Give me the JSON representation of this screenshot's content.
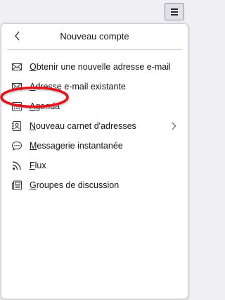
{
  "toolbar": {
    "menu_icon": "hamburger-menu-icon"
  },
  "panel": {
    "title": "Nouveau compte",
    "back_icon": "chevron-left-icon"
  },
  "items": [
    {
      "accel": "O",
      "rest": "btenir une nouvelle adresse e-mail",
      "icon": "envelope-new-icon",
      "submenu": false
    },
    {
      "accel": "A",
      "rest": "dresse e-mail existante",
      "icon": "envelope-icon",
      "submenu": false
    },
    {
      "accel": "A",
      "rest": "genda",
      "icon": "calendar-icon",
      "submenu": false
    },
    {
      "accel": "N",
      "rest": "ouveau carnet d'adresses",
      "icon": "address-book-icon",
      "submenu": true
    },
    {
      "accel": "M",
      "rest": "essagerie instantanée",
      "icon": "chat-bubble-icon",
      "submenu": false
    },
    {
      "accel": "F",
      "rest": "lux",
      "icon": "rss-feed-icon",
      "submenu": false
    },
    {
      "accel": "G",
      "rest": "roupes de discussion",
      "icon": "newsgroup-icon",
      "submenu": false
    }
  ],
  "colors": {
    "highlight_ring": "#e8131a",
    "text": "#15141a",
    "icon": "#3b3b45"
  }
}
